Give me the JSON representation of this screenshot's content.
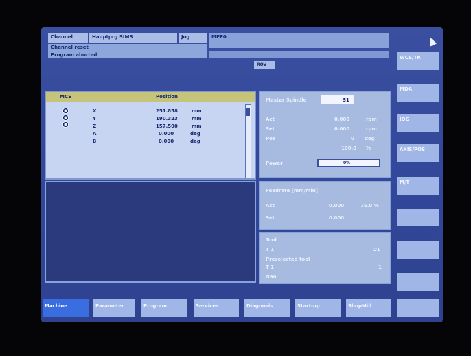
{
  "header": {
    "channel": "Channel",
    "program_name": "Hauptprg SIMS",
    "mode": "Jog",
    "mcs_label": "MPF0",
    "channel_reset": "Channel reset",
    "program_aborted": "Program aborted",
    "status_text": "ROV"
  },
  "position": {
    "col_mcs": "MCS",
    "col_position": "Position",
    "axes": [
      {
        "name": "X",
        "value": "251.858",
        "unit": "mm"
      },
      {
        "name": "Y",
        "value": "190.323",
        "unit": "mm"
      },
      {
        "name": "Z",
        "value": "157.500",
        "unit": "mm"
      },
      {
        "name": "A",
        "value": "0.000",
        "unit": "deg"
      },
      {
        "name": "B",
        "value": "0.000",
        "unit": "deg"
      }
    ]
  },
  "master_spindle": {
    "title": "Master Spindle",
    "spindle_no": "S1",
    "act_label": "Act",
    "act_value": "0.000",
    "act_unit": "rpm",
    "set_label": "Set",
    "set_value": "0.000",
    "set_unit": "rpm",
    "pos_label": "Pos",
    "pos_value": "0",
    "pos_unit": "deg",
    "override_value": "100.0",
    "override_unit": "%",
    "power_label": "Power",
    "power_value": "0%"
  },
  "feedrate": {
    "title": "Feedrate [mm/min]",
    "act_label": "Act",
    "act_value": "0.000",
    "act_pct": "75.0 %",
    "set_label": "Set",
    "set_value": "0.000"
  },
  "tool": {
    "title": "Tool",
    "tool_line": "T 1",
    "tool_value": "D1",
    "preselected": "Preselected tool",
    "pre_line": "T 1",
    "pre_value": "1",
    "g_functions": "G90"
  },
  "vertical_softkeys": [
    "WCS/TK",
    "MDA",
    "JOG",
    "AXIS/POS",
    "M/T",
    "",
    "",
    "",
    ""
  ],
  "horizontal_softkeys": [
    {
      "label": "Machine"
    },
    {
      "label": "Parameter"
    },
    {
      "label": "Program"
    },
    {
      "label": "Services"
    },
    {
      "label": "Diagnosis"
    },
    {
      "label": "Start-up"
    },
    {
      "label": "ShopMill"
    }
  ]
}
